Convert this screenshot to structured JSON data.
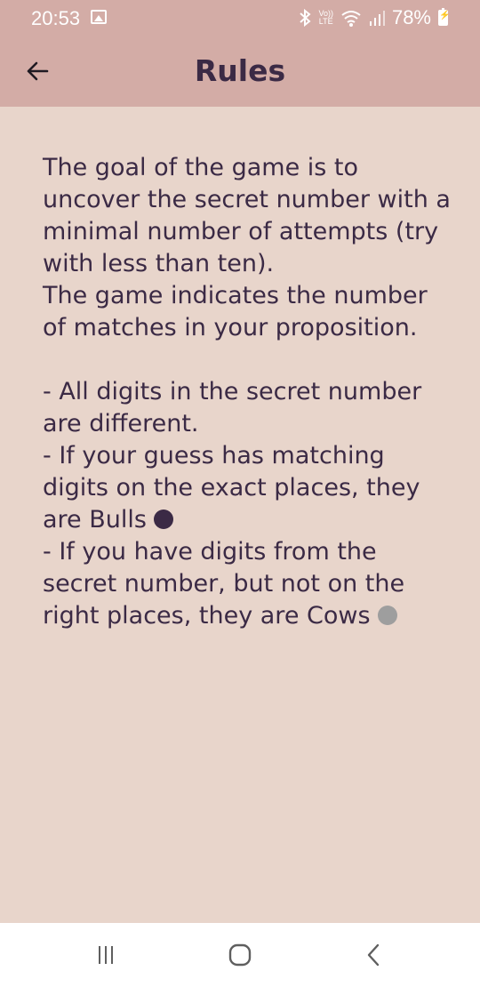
{
  "status_bar": {
    "time": "20:53",
    "battery": "78%",
    "volte_top": "Vo))",
    "volte_bottom": "LTE"
  },
  "app_bar": {
    "title": "Rules"
  },
  "rules": {
    "intro_1": "The goal of the game is to uncover the secret number with a minimal number of attempts (try with less than ten).",
    "intro_2": "The game indicates the number of matches in your proposition.",
    "rule_1": "- All digits in the secret number are different.",
    "rule_2": "- If your guess has matching digits on the exact places, they are Bulls",
    "rule_3": "- If you have digits from the secret number, but not on the right places, they are Cows"
  },
  "colors": {
    "background": "#e8d5cb",
    "app_bar": "#d3aca6",
    "text": "#3b2a45",
    "bulls_dot": "#3b2a45",
    "cows_dot": "#9e9e9e"
  },
  "icons": {
    "back": "arrow-left-icon",
    "bulls": "filled-circle-dark",
    "cows": "filled-circle-gray",
    "nav_recents": "recents-icon",
    "nav_home": "home-icon",
    "nav_back": "chevron-left-icon"
  }
}
